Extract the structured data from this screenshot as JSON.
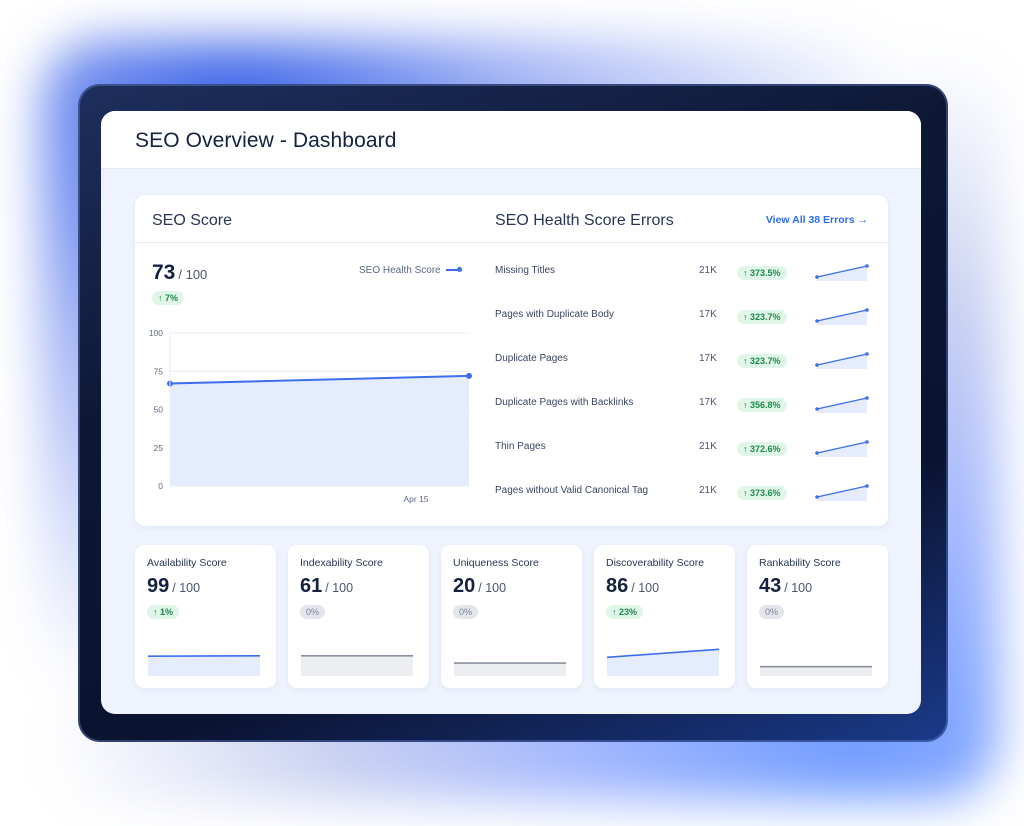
{
  "header": {
    "title": "SEO Overview - Dashboard"
  },
  "seo_score": {
    "title": "SEO Score",
    "value": "73",
    "max": "/ 100",
    "change": "↑ 7%",
    "legend": "SEO Health Score"
  },
  "errors": {
    "title": "SEO Health Score Errors",
    "view_all": "View All 38 Errors →",
    "rows": [
      {
        "name": "Missing Titles",
        "count": "21K",
        "change": "↑ 373.5%"
      },
      {
        "name": "Pages with Duplicate Body",
        "count": "17K",
        "change": "↑ 323.7%"
      },
      {
        "name": "Duplicate Pages",
        "count": "17K",
        "change": "↑ 323.7%"
      },
      {
        "name": "Duplicate Pages with Backlinks",
        "count": "17K",
        "change": "↑ 356.8%"
      },
      {
        "name": "Thin Pages",
        "count": "21K",
        "change": "↑ 372.6%"
      },
      {
        "name": "Pages without Valid Canonical Tag",
        "count": "21K",
        "change": "↑ 373.6%"
      }
    ]
  },
  "scores": [
    {
      "title": "Availability Score",
      "value": "99",
      "max": "/ 100",
      "change": "↑ 1%",
      "trend": "up",
      "color": "#3d6ef0",
      "start": 0.55,
      "end": 0.56
    },
    {
      "title": "Indexability Score",
      "value": "61",
      "max": "/ 100",
      "change": "0%",
      "trend": "flat",
      "color": "#8a909e",
      "start": 0.56,
      "end": 0.56
    },
    {
      "title": "Uniqueness Score",
      "value": "20",
      "max": "/ 100",
      "change": "0%",
      "trend": "flat",
      "color": "#8a909e",
      "start": 0.36,
      "end": 0.36
    },
    {
      "title": "Discoverability Score",
      "value": "86",
      "max": "/ 100",
      "change": "↑ 23%",
      "trend": "up",
      "color": "#3d6ef0",
      "start": 0.52,
      "end": 0.74
    },
    {
      "title": "Rankability Score",
      "value": "43",
      "max": "/ 100",
      "change": "0%",
      "trend": "flat",
      "color": "#8a909e",
      "start": 0.26,
      "end": 0.26
    }
  ],
  "chart_data": {
    "type": "area",
    "series": [
      {
        "name": "SEO Health Score",
        "values": [
          67,
          72
        ]
      }
    ],
    "x": [
      "",
      "Apr 15"
    ],
    "yticks": [
      "100",
      "75",
      "50",
      "25",
      "0"
    ],
    "ylim": [
      0,
      100
    ],
    "line_color": "#3d6ef0",
    "fill_color": "#e4ecfd",
    "grid": true
  }
}
